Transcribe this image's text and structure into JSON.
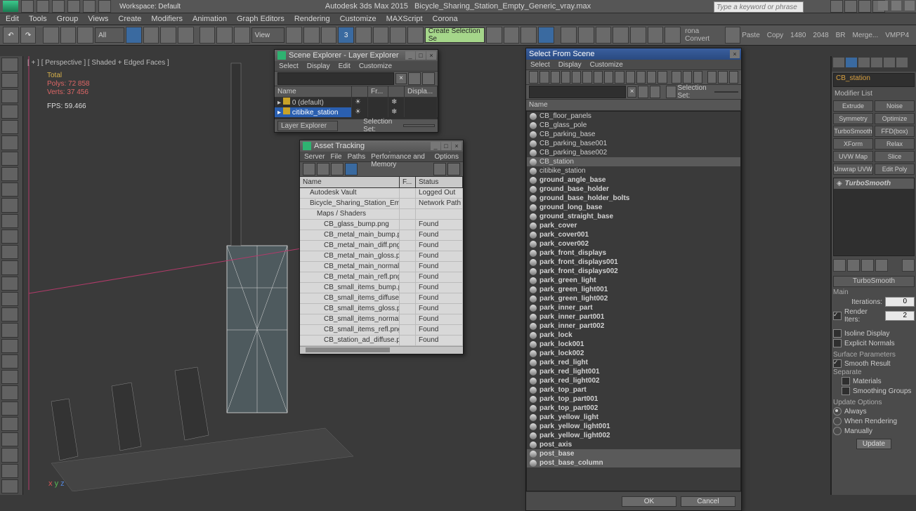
{
  "title": {
    "app": "Autodesk 3ds Max 2015",
    "file": "Bicycle_Sharing_Station_Empty_Generic_vray.max"
  },
  "workspace_label": "Workspace: Default",
  "search_placeholder": "Type a keyword or phrase",
  "main_menu": [
    "Edit",
    "Tools",
    "Group",
    "Views",
    "Create",
    "Modifiers",
    "Animation",
    "Graph Editors",
    "Rendering",
    "Customize",
    "MAXScript",
    "Corona"
  ],
  "toolbar_dropdowns": {
    "filter": "All",
    "view": "View",
    "selset": "Create Selection Se"
  },
  "toolbar_right": {
    "conv": "rona Convert",
    "paste": "Paste",
    "copy": "Copy",
    "n1": "1480",
    "n2": "2048",
    "br": "BR",
    "merge": "Merge...",
    "vmpp": "VMPP4"
  },
  "viewport": {
    "label": "[ + ] [ Perspective ] [ Shaded + Edged Faces ]",
    "stats": {
      "h": "Total",
      "polys": "Polys: 72 858",
      "verts": "Verts: 37 456",
      "fps": "FPS: 59.466"
    }
  },
  "scene_explorer": {
    "title": "Scene Explorer - Layer Explorer",
    "menu": [
      "Select",
      "Display",
      "Edit",
      "Customize"
    ],
    "cols": [
      "Name",
      "",
      "",
      "Fr...",
      "",
      "Displa..."
    ],
    "rows": [
      {
        "name": "0 (default)",
        "sel": false
      },
      {
        "name": "citibike_station",
        "sel": true
      }
    ],
    "status": {
      "left": "Layer Explorer",
      "right": "Selection Set:"
    }
  },
  "asset_tracking": {
    "title": "Asset Tracking",
    "menu": [
      "Server",
      "File",
      "Paths",
      "Bitmap Performance and Memory",
      "Options"
    ],
    "cols": {
      "name": "Name",
      "f": "F...",
      "status": "Status"
    },
    "rows": [
      {
        "name": "Autodesk Vault",
        "status": "Logged Out",
        "indent": 1,
        "icon": "vault"
      },
      {
        "name": "Bicycle_Sharing_Station_Empty_G...",
        "status": "Network Path",
        "indent": 1,
        "icon": "file"
      },
      {
        "name": "Maps / Shaders",
        "status": "",
        "indent": 2,
        "icon": "folder"
      },
      {
        "name": "CB_glass_bump.png",
        "status": "Found",
        "indent": 3,
        "icon": "map"
      },
      {
        "name": "CB_metal_main_bump.png",
        "status": "Found",
        "indent": 3,
        "icon": "map"
      },
      {
        "name": "CB_metal_main_diff.png",
        "status": "Found",
        "indent": 3,
        "icon": "map"
      },
      {
        "name": "CB_metal_main_gloss.png",
        "status": "Found",
        "indent": 3,
        "icon": "map"
      },
      {
        "name": "CB_metal_main_normal.png",
        "status": "Found",
        "indent": 3,
        "icon": "map"
      },
      {
        "name": "CB_metal_main_refl.png",
        "status": "Found",
        "indent": 3,
        "icon": "map"
      },
      {
        "name": "CB_small_items_bump.png",
        "status": "Found",
        "indent": 3,
        "icon": "map"
      },
      {
        "name": "CB_small_items_diffuse.png",
        "status": "Found",
        "indent": 3,
        "icon": "map"
      },
      {
        "name": "CB_small_items_gloss.png",
        "status": "Found",
        "indent": 3,
        "icon": "map"
      },
      {
        "name": "CB_small_items_normal.png",
        "status": "Found",
        "indent": 3,
        "icon": "map"
      },
      {
        "name": "CB_small_items_refl.png",
        "status": "Found",
        "indent": 3,
        "icon": "map"
      },
      {
        "name": "CB_station_ad_diffuse.png",
        "status": "Found",
        "indent": 3,
        "icon": "map"
      }
    ]
  },
  "select_from_scene": {
    "title": "Select From Scene",
    "menu": [
      "Select",
      "Display",
      "Customize"
    ],
    "header": "Name",
    "sel_label": "Selection Set:",
    "items": [
      {
        "n": "CB_floor_panels"
      },
      {
        "n": "CB_glass_pole"
      },
      {
        "n": "CB_parking_base"
      },
      {
        "n": "CB_parking_base001"
      },
      {
        "n": "CB_parking_base002"
      },
      {
        "n": "CB_station",
        "sel": true
      },
      {
        "n": "citibike_station"
      },
      {
        "n": "ground_angle_base",
        "b": true
      },
      {
        "n": "ground_base_holder",
        "b": true
      },
      {
        "n": "ground_base_holder_bolts",
        "b": true
      },
      {
        "n": "ground_long_base",
        "b": true
      },
      {
        "n": "ground_straight_base",
        "b": true
      },
      {
        "n": "park_cover",
        "b": true
      },
      {
        "n": "park_cover001",
        "b": true
      },
      {
        "n": "park_cover002",
        "b": true
      },
      {
        "n": "park_front_displays",
        "b": true
      },
      {
        "n": "park_front_displays001",
        "b": true
      },
      {
        "n": "park_front_displays002",
        "b": true
      },
      {
        "n": "park_green_light",
        "b": true
      },
      {
        "n": "park_green_light001",
        "b": true
      },
      {
        "n": "park_green_light002",
        "b": true
      },
      {
        "n": "park_inner_part",
        "b": true
      },
      {
        "n": "park_inner_part001",
        "b": true
      },
      {
        "n": "park_inner_part002",
        "b": true
      },
      {
        "n": "park_lock",
        "b": true
      },
      {
        "n": "park_lock001",
        "b": true
      },
      {
        "n": "park_lock002",
        "b": true
      },
      {
        "n": "park_red_light",
        "b": true
      },
      {
        "n": "park_red_light001",
        "b": true
      },
      {
        "n": "park_red_light002",
        "b": true
      },
      {
        "n": "park_top_part",
        "b": true
      },
      {
        "n": "park_top_part001",
        "b": true
      },
      {
        "n": "park_top_part002",
        "b": true
      },
      {
        "n": "park_yellow_light",
        "b": true
      },
      {
        "n": "park_yellow_light001",
        "b": true
      },
      {
        "n": "park_yellow_light002",
        "b": true
      },
      {
        "n": "post_axis",
        "b": true
      },
      {
        "n": "post_base",
        "b": true,
        "sel2": true
      },
      {
        "n": "post_base_column",
        "b": true,
        "sel2": true
      }
    ],
    "buttons": {
      "ok": "OK",
      "cancel": "Cancel"
    }
  },
  "cmd_panel": {
    "obj": "CB_station",
    "mod_list": "Modifier List",
    "mods": [
      [
        "Extrude",
        "Noise"
      ],
      [
        "Symmetry",
        "Optimize"
      ],
      [
        "TurboSmooth",
        "FFD(box)"
      ],
      [
        "XForm",
        "Relax"
      ],
      [
        "UVW Map",
        "Slice"
      ],
      [
        "Unwrap UVW",
        "Edit Poly"
      ]
    ],
    "stack": [
      {
        "n": "TurboSmooth",
        "sel": true
      }
    ],
    "rollout": "TurboSmooth",
    "sect_main": "Main",
    "iter_label": "Iterations:",
    "iter_val": "0",
    "rend_label": "Render Iters:",
    "rend_val": "2",
    "isoline": "Isoline Display",
    "explicit": "Explicit Normals",
    "sect_surf": "Surface Parameters",
    "smooth": "Smooth Result",
    "sep": "Separate",
    "mats": "Materials",
    "sg": "Smoothing Groups",
    "sect_upd": "Update Options",
    "always": "Always",
    "when": "When Rendering",
    "man": "Manually",
    "update": "Update"
  }
}
